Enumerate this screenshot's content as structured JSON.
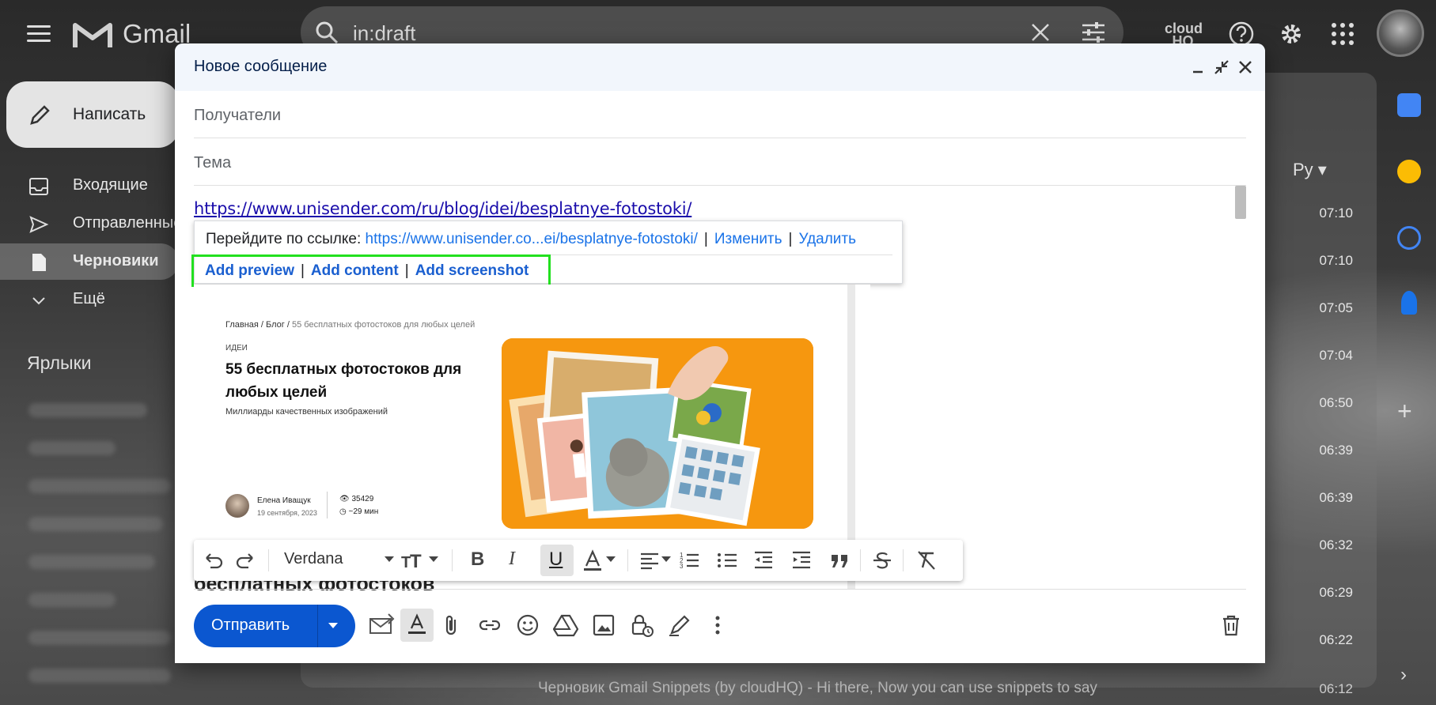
{
  "gmail": {
    "app_name": "Gmail",
    "search_query": "in:draft",
    "cloudhq_logo": "cloud HQ",
    "compose_label": "Написать",
    "nav": [
      {
        "label": "Входящие",
        "icon": "inbox-icon"
      },
      {
        "label": "Отправленные",
        "icon": "send-icon"
      },
      {
        "label": "Черновики",
        "icon": "draft-icon"
      },
      {
        "label": "Ещё",
        "icon": "chevron-down-icon"
      }
    ],
    "labels_heading": "Ярлыки",
    "sort_label": "Ру ▾",
    "times": [
      "07:10",
      "07:10",
      "07:05",
      "07:04",
      "06:50",
      "06:39",
      "06:39",
      "06:32",
      "06:29",
      "06:22"
    ],
    "bottom_row": "Черновик    Gmail Snippets (by cloudHQ) - Hi there, Now you can use snippets to say",
    "bottom_time": "06:12"
  },
  "compose": {
    "title": "Новое сообщение",
    "recipients_placeholder": "Получатели",
    "subject_placeholder": "Тема",
    "body_link": "https://www.unisender.com/ru/blog/idei/besplatnye-fotostoki/",
    "popup": {
      "goto_label": "Перейдите по ссылке:",
      "short_url": "https://www.unisender.co...ei/besplatnye-fotostoki/",
      "change": "Изменить",
      "delete": "Удалить",
      "add_preview": "Add preview",
      "add_content": "Add content",
      "add_screenshot": "Add screenshot",
      "separator": "|"
    },
    "preview": {
      "breadcrumb_main": "Главная / Блог /",
      "breadcrumb_tail": "55 бесплатных фотостоков для любых целей",
      "tag": "ИДЕИ",
      "title": "55 бесплатных фотостоков для любых целей",
      "subtitle": "Миллиарды качественных изображений",
      "author": "Елена Иващук",
      "date": "19 сентября, 2023",
      "views": "35429",
      "read_time": "~29 мин"
    },
    "cut_heading": "бесплатных фотостоков",
    "format_font": "Verdana",
    "bold": "B",
    "italic": "I",
    "underline": "U",
    "send_label": "Отправить"
  }
}
